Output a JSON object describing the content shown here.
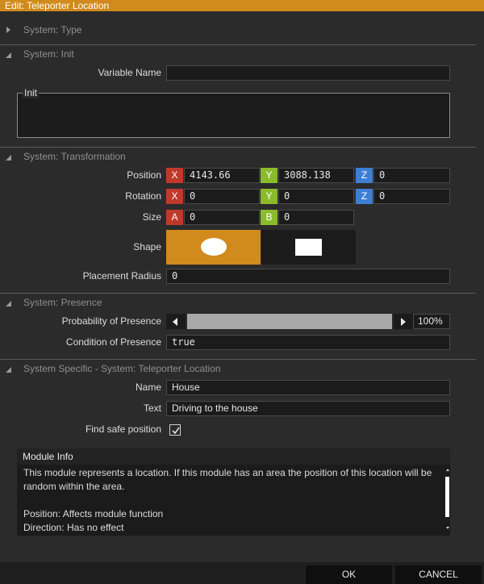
{
  "window": {
    "title": "Edit: Teleporter Location"
  },
  "sections": {
    "type": {
      "label": "System: Type"
    },
    "init": {
      "label": "System: Init",
      "variable_name_label": "Variable Name",
      "variable_name_value": "",
      "init_label": "Init"
    },
    "transformation": {
      "label": "System: Transformation",
      "position_label": "Position",
      "position": {
        "x": "4143.66",
        "y": "3088.138",
        "z": "0"
      },
      "rotation_label": "Rotation",
      "rotation": {
        "x": "0",
        "y": "0",
        "z": "0"
      },
      "size_label": "Size",
      "size": {
        "a": "0",
        "b": "0"
      },
      "shape_label": "Shape",
      "shape_selected": "ellipse",
      "placement_radius_label": "Placement Radius",
      "placement_radius": "0"
    },
    "presence": {
      "label": "System: Presence",
      "probability_label": "Probability of Presence",
      "probability_value": "100%",
      "probability_fraction": 1.0,
      "condition_label": "Condition of Presence",
      "condition_value": "true"
    },
    "specific": {
      "label": "System Specific - System: Teleporter Location",
      "name_label": "Name",
      "name_value": "House",
      "text_label": "Text",
      "text_value": "Driving to the house",
      "safe_label": "Find safe position",
      "safe_checked": true
    }
  },
  "axis": {
    "x": "X",
    "y": "Y",
    "z": "Z",
    "a": "A",
    "b": "B"
  },
  "module_info": {
    "title": "Module Info",
    "line1": "This module represents a location. If this module has an area the position of this location will be random within the area.",
    "line2": "Position: Affects module function",
    "line3": "Direction: Has no effect"
  },
  "buttons": {
    "ok": "OK",
    "cancel": "CANCEL"
  },
  "colors": {
    "accent": "#d18a1c",
    "axis_red": "#c0392b",
    "axis_green": "#8bbb2b",
    "axis_blue": "#3e7fd6"
  }
}
